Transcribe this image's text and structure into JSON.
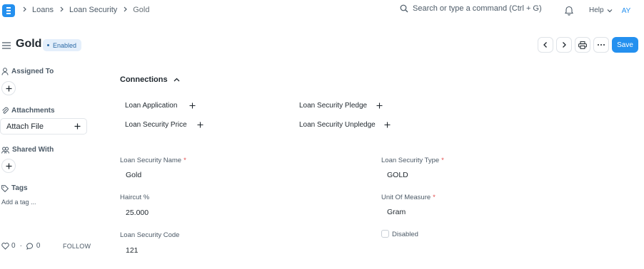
{
  "navbar": {
    "breadcrumbs": [
      "Loans",
      "Loan Security",
      "Gold"
    ],
    "search_placeholder": "Search or type a command (Ctrl + G)",
    "help_label": "Help",
    "avatar_initials": "AY"
  },
  "header": {
    "title": "Gold",
    "status_badge": "Enabled",
    "save_label": "Save"
  },
  "sidebar": {
    "assigned_to": "Assigned To",
    "attachments": "Attachments",
    "attach_file": "Attach File",
    "shared_with": "Shared With",
    "tags": "Tags",
    "add_tag": "Add a tag ...",
    "likes": "0",
    "comments": "0",
    "follow": "FOLLOW"
  },
  "connections": {
    "title": "Connections",
    "items": [
      "Loan Application",
      "Loan Security Pledge",
      "Loan Security Price",
      "Loan Security Unpledge"
    ]
  },
  "form": {
    "loan_security_name": {
      "label": "Loan Security Name",
      "value": "Gold"
    },
    "loan_security_type": {
      "label": "Loan Security Type",
      "value": "GOLD"
    },
    "haircut": {
      "label": "Haircut %",
      "value": "25.000"
    },
    "unit_of_measure": {
      "label": "Unit Of Measure",
      "value": "Gram"
    },
    "loan_security_code": {
      "label": "Loan Security Code",
      "value": "121"
    },
    "disabled": {
      "label": "Disabled",
      "checked": false
    }
  },
  "colors": {
    "accent": "#2490ef",
    "badge_bg": "#e4effb",
    "badge_text": "#2b6aa6",
    "required": "#e24c4c"
  }
}
